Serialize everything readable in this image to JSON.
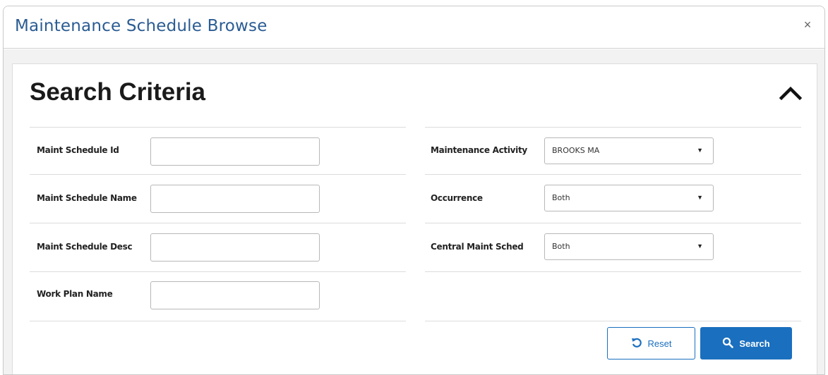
{
  "window": {
    "title": "Maintenance Schedule Browse",
    "close_label": "×"
  },
  "card": {
    "title": "Search Criteria"
  },
  "left_fields": [
    {
      "label": "Maint Schedule Id",
      "value": "",
      "placeholder": ""
    },
    {
      "label": "Maint Schedule Name",
      "value": "",
      "placeholder": ""
    },
    {
      "label": "Maint Schedule Desc",
      "value": "",
      "placeholder": ""
    },
    {
      "label": "Work Plan Name",
      "value": "",
      "placeholder": ""
    }
  ],
  "right_fields": [
    {
      "label": "Maintenance Activity",
      "value": "BROOKS MA"
    },
    {
      "label": "Occurrence",
      "value": "Both"
    },
    {
      "label": "Central Maint Sched",
      "value": "Both"
    }
  ],
  "buttons": {
    "reset_label": "Reset",
    "search_label": "Search"
  },
  "icons": {
    "collapse": "chevron-up-icon",
    "reset": "undo-icon",
    "search": "search-icon",
    "caret": "caret-down-icon"
  },
  "colors": {
    "title_blue": "#2b5c93",
    "primary": "#1a6fbf"
  }
}
